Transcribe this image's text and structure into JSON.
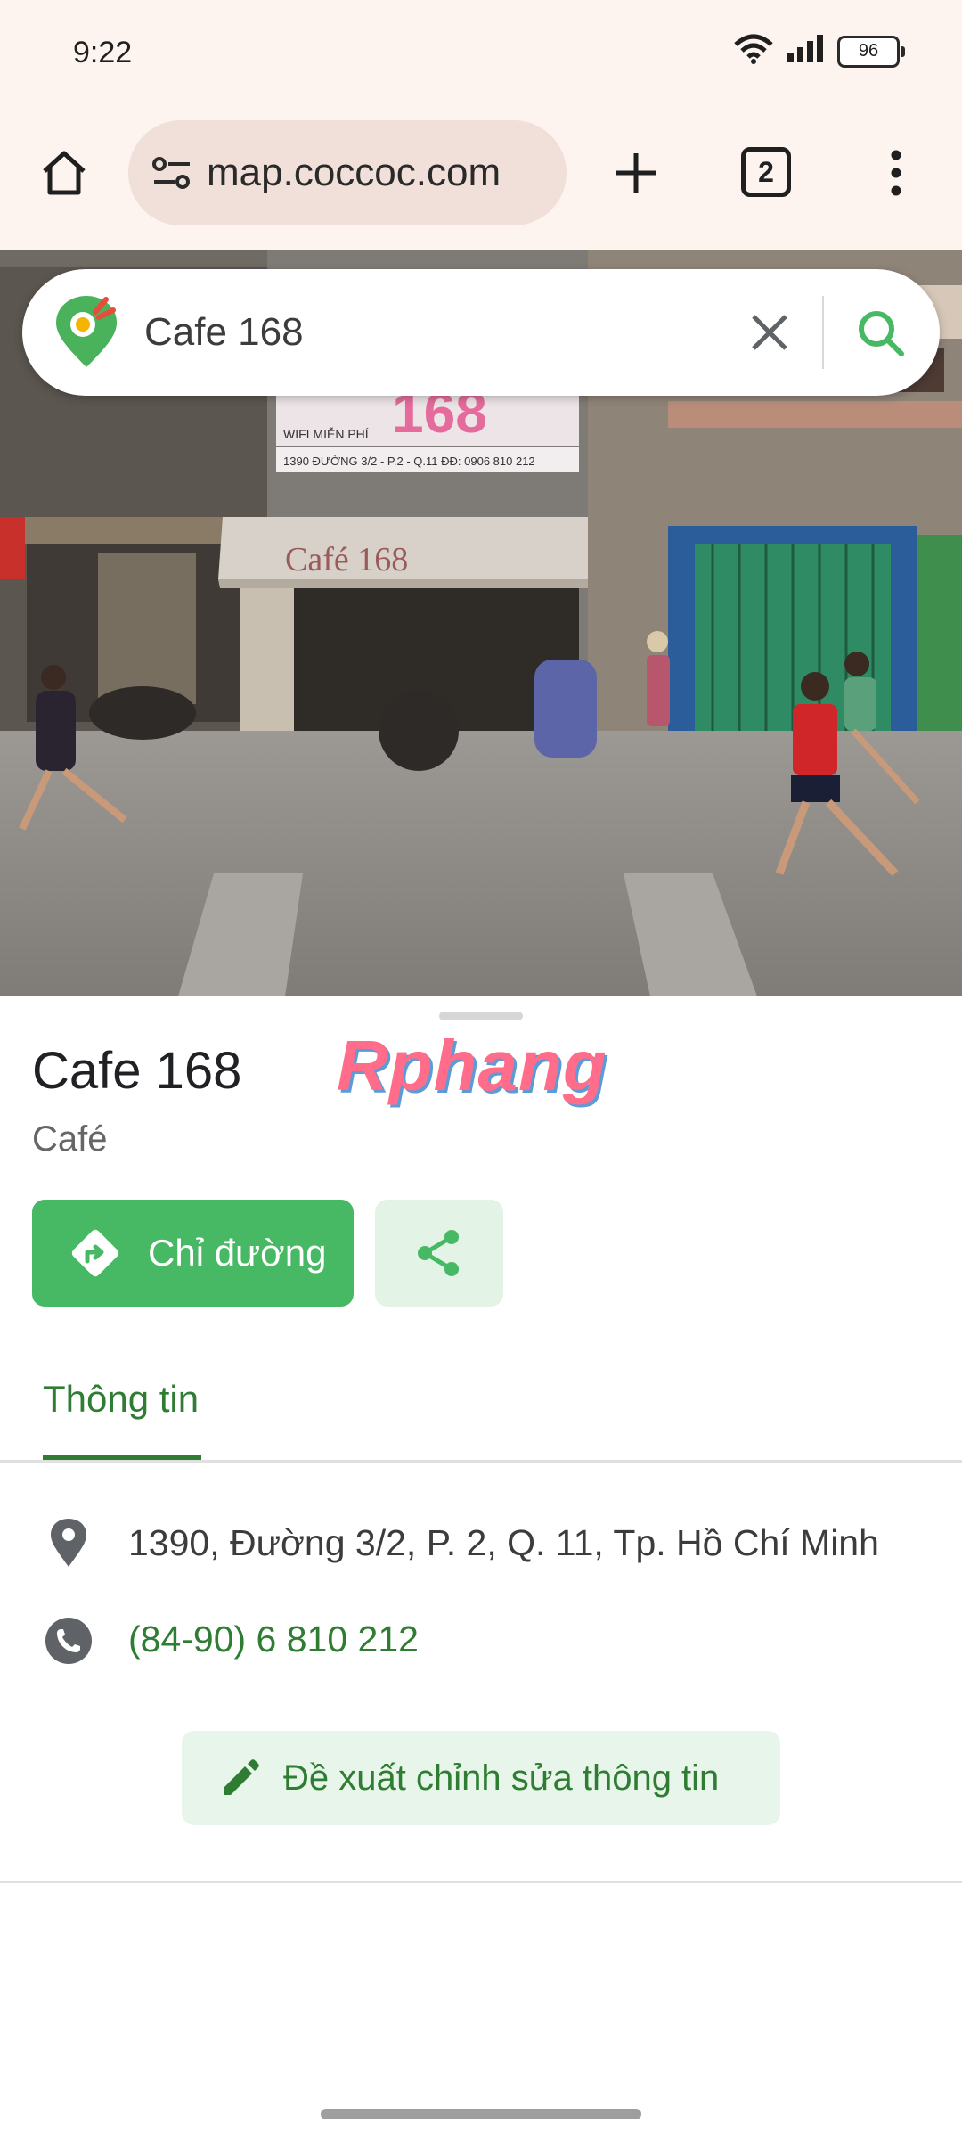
{
  "status": {
    "time": "9:22",
    "battery": "96"
  },
  "browser": {
    "url": "map.coccoc.com",
    "tab_count": "2"
  },
  "search": {
    "query": "Cafe 168"
  },
  "place": {
    "name": "Cafe 168",
    "category": "Café",
    "watermark": "Rphang",
    "directions_label": "Chỉ đường",
    "tab_info_label": "Thông tin",
    "address": "1390, Đường 3/2, P. 2, Q. 11, Tp. Hồ Chí Minh",
    "phone": "(84-90) 6 810 212",
    "suggest_edit_label": "Đề xuất chỉnh sửa thông tin"
  },
  "photo_signs": {
    "sign_number": "168",
    "sign_wifi": "WIFI MIỄN PHÍ",
    "sign_address": "1390 ĐƯỜNG 3/2 - P.2 - Q.11   ĐĐ: 0906 810 212",
    "awning": "Café 168"
  },
  "colors": {
    "accent": "#47b863",
    "accent_dark": "#2e7d32",
    "toolbar_bg": "#fdf3ef",
    "url_pill_bg": "#f0e0d9"
  },
  "icons": [
    "home-icon",
    "tune-icon",
    "plus-icon",
    "tab-switcher-icon",
    "more-vert-icon",
    "coccoc-logo",
    "close-icon",
    "search-icon",
    "directions-icon",
    "share-icon",
    "location-pin-icon",
    "phone-icon",
    "edit-pencil-icon",
    "wifi-icon",
    "signal-icon",
    "battery-icon"
  ]
}
